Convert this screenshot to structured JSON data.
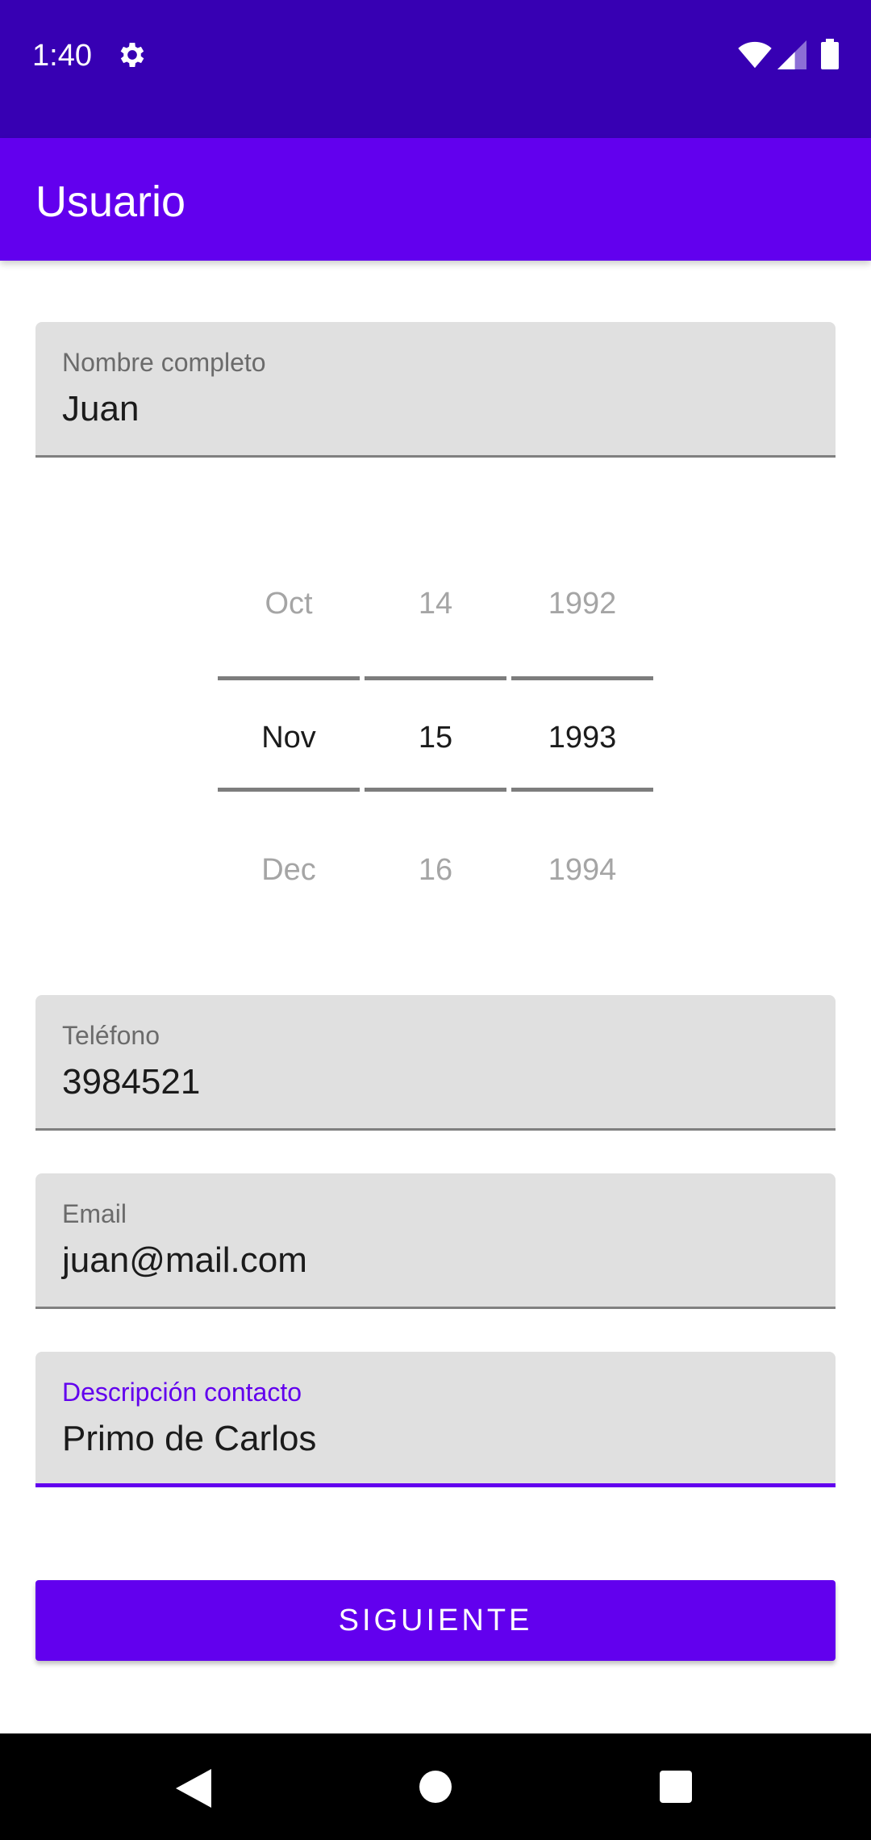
{
  "status_bar": {
    "time": "1:40",
    "icons": [
      "gear-icon",
      "wifi-icon",
      "signal-icon",
      "battery-icon"
    ]
  },
  "app_bar": {
    "title": "Usuario"
  },
  "form": {
    "name": {
      "label": "Nombre completo",
      "value": "Juan"
    },
    "date_picker": {
      "month": {
        "prev": "Oct",
        "selected": "Nov",
        "next": "Dec"
      },
      "day": {
        "prev": "14",
        "selected": "15",
        "next": "16"
      },
      "year": {
        "prev": "1992",
        "selected": "1993",
        "next": "1994"
      }
    },
    "phone": {
      "label": "Teléfono",
      "value": "3984521"
    },
    "email": {
      "label": "Email",
      "value": "juan@mail.com"
    },
    "description": {
      "label": "Descripción contacto",
      "value": "Primo de Carlos"
    }
  },
  "actions": {
    "next_label": "SIGUIENTE"
  },
  "nav_bar": {
    "icons": [
      "back-icon",
      "home-icon",
      "recents-icon"
    ]
  },
  "colors": {
    "status_bar": "#3700b3",
    "primary": "#6200ee",
    "field_background": "#e0e0e0"
  }
}
